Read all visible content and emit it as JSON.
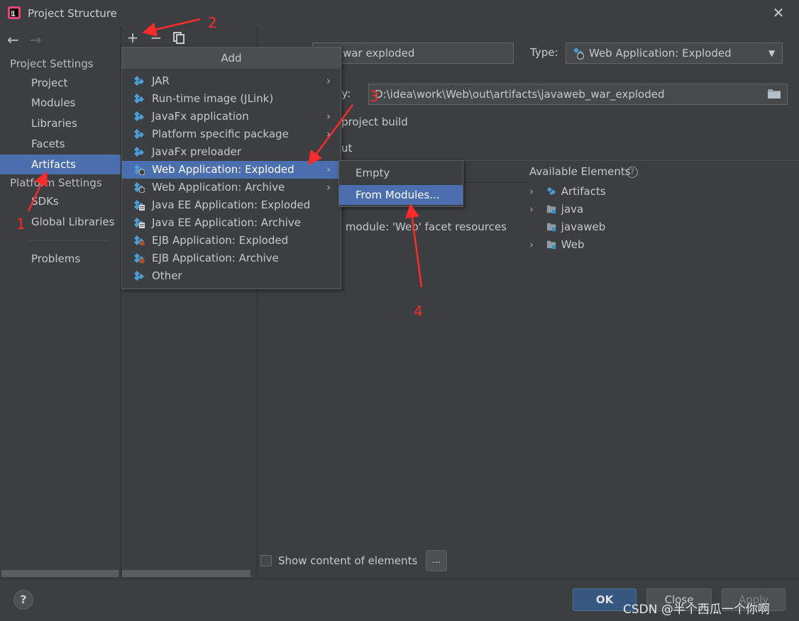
{
  "window": {
    "title": "Project Structure"
  },
  "nav": {
    "project_settings_header": "Project Settings",
    "project_items": [
      "Project",
      "Modules",
      "Libraries",
      "Facets",
      "Artifacts"
    ],
    "platform_settings_header": "Platform Settings",
    "platform_items": [
      "SDKs",
      "Global Libraries"
    ],
    "problems": "Problems",
    "selected": "Artifacts"
  },
  "artifact": {
    "name_value": "web:war exploded",
    "type_label": "Type:",
    "type_value": "Web Application: Exploded",
    "output_dir_label": "ory:",
    "output_dir_value": "D:\\idea\\work\\Web\\out\\artifacts\\javaweb_war_exploded",
    "include_build_text": "project build",
    "output_layout_text": "ut",
    "module_facet_text": "' module: 'Web' facet resources",
    "available_elements_label": "Available Elements",
    "tree": [
      "Artifacts",
      "java",
      "javaweb",
      "Web"
    ],
    "show_content_label": "Show content of elements",
    "dots_label": "..."
  },
  "add_menu": {
    "header": "Add",
    "items": [
      "JAR",
      "Run-time image (JLink)",
      "JavaFx application",
      "Platform specific package",
      "JavaFx preloader",
      "Web Application: Exploded",
      "Web Application: Archive",
      "Java EE Application: Exploded",
      "Java EE Application: Archive",
      "EJB Application: Exploded",
      "EJB Application: Archive",
      "Other"
    ],
    "selected": "Web Application: Exploded"
  },
  "sub_menu": {
    "items": [
      "Empty",
      "From Modules..."
    ],
    "selected": "From Modules..."
  },
  "buttons": {
    "ok": "OK",
    "close": "Close",
    "apply": "Apply",
    "help": "?"
  },
  "annotations": [
    "1",
    "2",
    "3",
    "4"
  ],
  "watermark": "CSDN @半个西瓜一个你啊",
  "colors": {
    "selection": "#4b6eaf",
    "annotation": "#ff2a2a",
    "background": "#3c3f41"
  }
}
